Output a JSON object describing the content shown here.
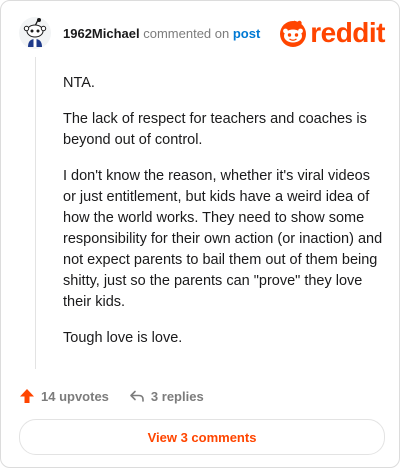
{
  "header": {
    "username": "1962Michael",
    "action_text": "commented on",
    "post_link": "post",
    "logo_text": "reddit"
  },
  "comment": {
    "paragraphs": [
      "NTA.",
      "The lack of respect for teachers and coaches is beyond out of control.",
      "I don't know the reason, whether it's viral videos or just entitlement, but kids have a weird idea of how the world works. They need to show some responsibility for their own action (or inaction) and not expect parents to bail them out of them being shitty, just so the parents can \"prove\" they love their kids.",
      "Tough love is love."
    ]
  },
  "actions": {
    "upvotes_label": "14 upvotes",
    "replies_label": "3 replies"
  },
  "footer": {
    "view_comments_label": "View 3 comments"
  },
  "colors": {
    "brand": "#ff4500",
    "link": "#0079d3",
    "muted": "#7c7c7c"
  },
  "icons": {
    "avatar": "snoo-avatar-icon",
    "logo": "reddit-snoo-icon",
    "upvote": "upvote-arrow-icon",
    "reply": "reply-arrow-icon"
  }
}
